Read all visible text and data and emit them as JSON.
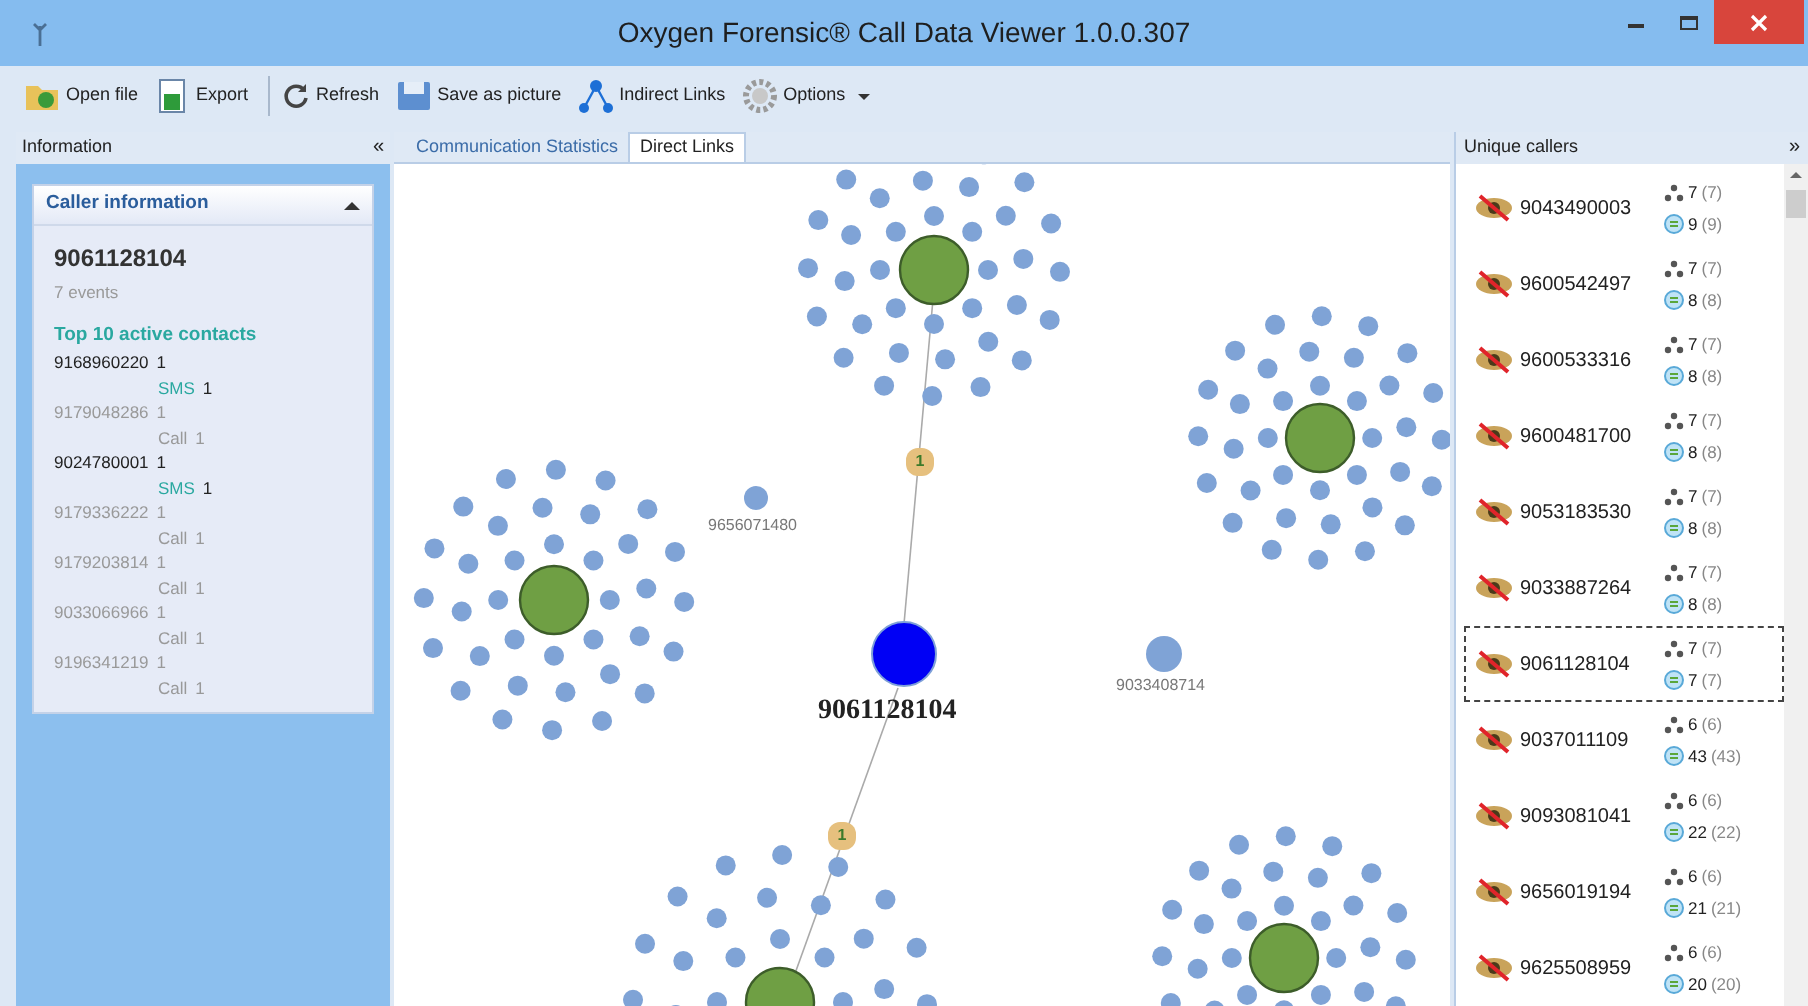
{
  "window": {
    "title": "Oxygen Forensic® Call Data Viewer 1.0.0.307"
  },
  "toolbar": [
    {
      "kind": "open",
      "label": "Open file"
    },
    {
      "kind": "export",
      "label": "Export"
    },
    {
      "kind": "refresh",
      "label": "Refresh"
    },
    {
      "kind": "save",
      "label": "Save as picture"
    },
    {
      "kind": "links",
      "label": "Indirect Links"
    },
    {
      "kind": "options",
      "label": "Options"
    }
  ],
  "info_panel": {
    "title": "Information",
    "collapse": "«",
    "card": {
      "title": "Caller information",
      "number": "9061128104",
      "events": "7 events",
      "contacts_title": "Top 10 active contacts",
      "contacts": [
        {
          "number": "9168960220",
          "count": "1",
          "type": "SMS",
          "type_count": "1",
          "kind": "sms"
        },
        {
          "number": "9179048286",
          "count": "1",
          "type": "Call",
          "type_count": "1",
          "kind": "call"
        },
        {
          "number": "9024780001",
          "count": "1",
          "type": "SMS",
          "type_count": "1",
          "kind": "sms"
        },
        {
          "number": "9179336222",
          "count": "1",
          "type": "Call",
          "type_count": "1",
          "kind": "call"
        },
        {
          "number": "9179203814",
          "count": "1",
          "type": "Call",
          "type_count": "1",
          "kind": "call"
        },
        {
          "number": "9033066966",
          "count": "1",
          "type": "Call",
          "type_count": "1",
          "kind": "call"
        },
        {
          "number": "9196341219",
          "count": "1",
          "type": "Call",
          "type_count": "1",
          "kind": "call"
        }
      ]
    }
  },
  "tabs": [
    {
      "label": "Communication Statistics",
      "selected": false
    },
    {
      "label": "Direct Links",
      "selected": true
    }
  ],
  "graph": {
    "center": {
      "label": "9061128104"
    },
    "edge_badges": [
      "1",
      "1"
    ],
    "nodes": [
      {
        "label": "9656071480"
      },
      {
        "label": "9033408714"
      }
    ]
  },
  "callers_panel": {
    "title": "Unique callers",
    "collapse": "»",
    "rows": [
      {
        "number": "9043490003",
        "contacts": "7",
        "contacts_total": "(7)",
        "events": "9",
        "events_total": "(9)",
        "selected": false
      },
      {
        "number": "9600542497",
        "contacts": "7",
        "contacts_total": "(7)",
        "events": "8",
        "events_total": "(8)",
        "selected": false
      },
      {
        "number": "9600533316",
        "contacts": "7",
        "contacts_total": "(7)",
        "events": "8",
        "events_total": "(8)",
        "selected": false
      },
      {
        "number": "9600481700",
        "contacts": "7",
        "contacts_total": "(7)",
        "events": "8",
        "events_total": "(8)",
        "selected": false
      },
      {
        "number": "9053183530",
        "contacts": "7",
        "contacts_total": "(7)",
        "events": "8",
        "events_total": "(8)",
        "selected": false
      },
      {
        "number": "9033887264",
        "contacts": "7",
        "contacts_total": "(7)",
        "events": "8",
        "events_total": "(8)",
        "selected": false
      },
      {
        "number": "9061128104",
        "contacts": "7",
        "contacts_total": "(7)",
        "events": "7",
        "events_total": "(7)",
        "selected": true
      },
      {
        "number": "9037011109",
        "contacts": "6",
        "contacts_total": "(6)",
        "events": "43",
        "events_total": "(43)",
        "selected": false
      },
      {
        "number": "9093081041",
        "contacts": "6",
        "contacts_total": "(6)",
        "events": "22",
        "events_total": "(22)",
        "selected": false
      },
      {
        "number": "9656019194",
        "contacts": "6",
        "contacts_total": "(6)",
        "events": "21",
        "events_total": "(21)",
        "selected": false
      },
      {
        "number": "9625508959",
        "contacts": "6",
        "contacts_total": "(6)",
        "events": "20",
        "events_total": "(20)",
        "selected": false
      }
    ]
  }
}
